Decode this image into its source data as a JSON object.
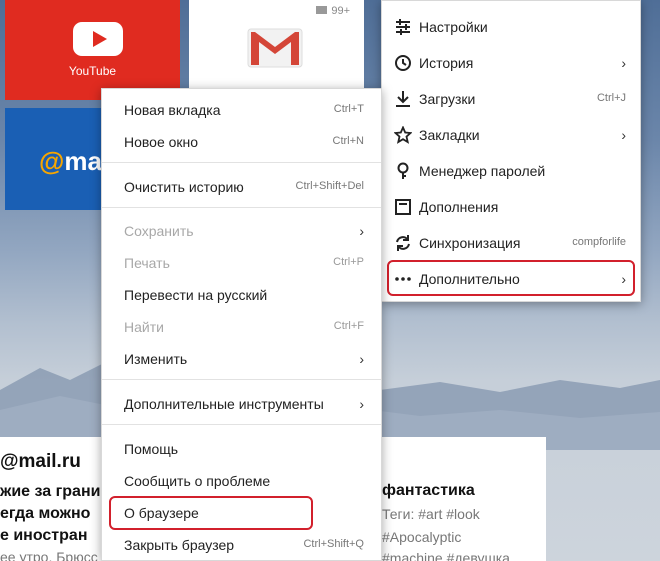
{
  "tiles": {
    "youtube_label": "YouTube",
    "gmail_count": "99+",
    "mail_label_at": "@",
    "mail_label_text": "ma"
  },
  "news": {
    "source": "@mail.ru",
    "left_lines": [
      "жие за грани",
      "егда можно",
      "е иностран",
      "ее утро. Брюсс"
    ],
    "right_title": "фантастика",
    "right_lines": [
      "Теги: #art #look",
      "#Apocalyptic",
      "#machine #девушка"
    ]
  },
  "context_menu": {
    "items": [
      {
        "label": "Новая вкладка",
        "shortcut": "Ctrl+T"
      },
      {
        "label": "Новое окно",
        "shortcut": "Ctrl+N"
      },
      {
        "label": "Очистить историю",
        "shortcut": "Ctrl+Shift+Del"
      },
      {
        "label": "Сохранить",
        "arrow": "›"
      },
      {
        "label": "Печать",
        "shortcut": "Ctrl+P"
      },
      {
        "label": "Перевести на русский"
      },
      {
        "label": "Найти",
        "shortcut": "Ctrl+F"
      },
      {
        "label": "Изменить",
        "arrow": "›"
      },
      {
        "label": "Дополнительные инструменты",
        "arrow": "›"
      },
      {
        "label": "Помощь"
      },
      {
        "label": "Сообщить о проблеме"
      },
      {
        "label": "О браузере"
      },
      {
        "label": "Закрыть браузер",
        "shortcut": "Ctrl+Shift+Q"
      }
    ]
  },
  "main_menu": {
    "items": [
      {
        "label": "Настройки",
        "icon": "settings-sliders-icon"
      },
      {
        "label": "История",
        "icon": "clock-icon",
        "arrow": "›"
      },
      {
        "label": "Загрузки",
        "icon": "download-icon",
        "shortcut": "Ctrl+J"
      },
      {
        "label": "Закладки",
        "icon": "star-icon",
        "arrow": "›"
      },
      {
        "label": "Менеджер паролей",
        "icon": "key-icon"
      },
      {
        "label": "Дополнения",
        "icon": "extensions-icon"
      },
      {
        "label": "Синхронизация",
        "icon": "sync-icon",
        "shortcut": "compforlife"
      },
      {
        "label": "Дополнительно",
        "icon": "more-dots-icon",
        "arrow": "›"
      }
    ]
  },
  "colors": {
    "highlight": "#d2202c",
    "youtube_red": "#e02b20",
    "mail_blue": "#1a5fb4",
    "mail_orange": "#f7a600"
  }
}
